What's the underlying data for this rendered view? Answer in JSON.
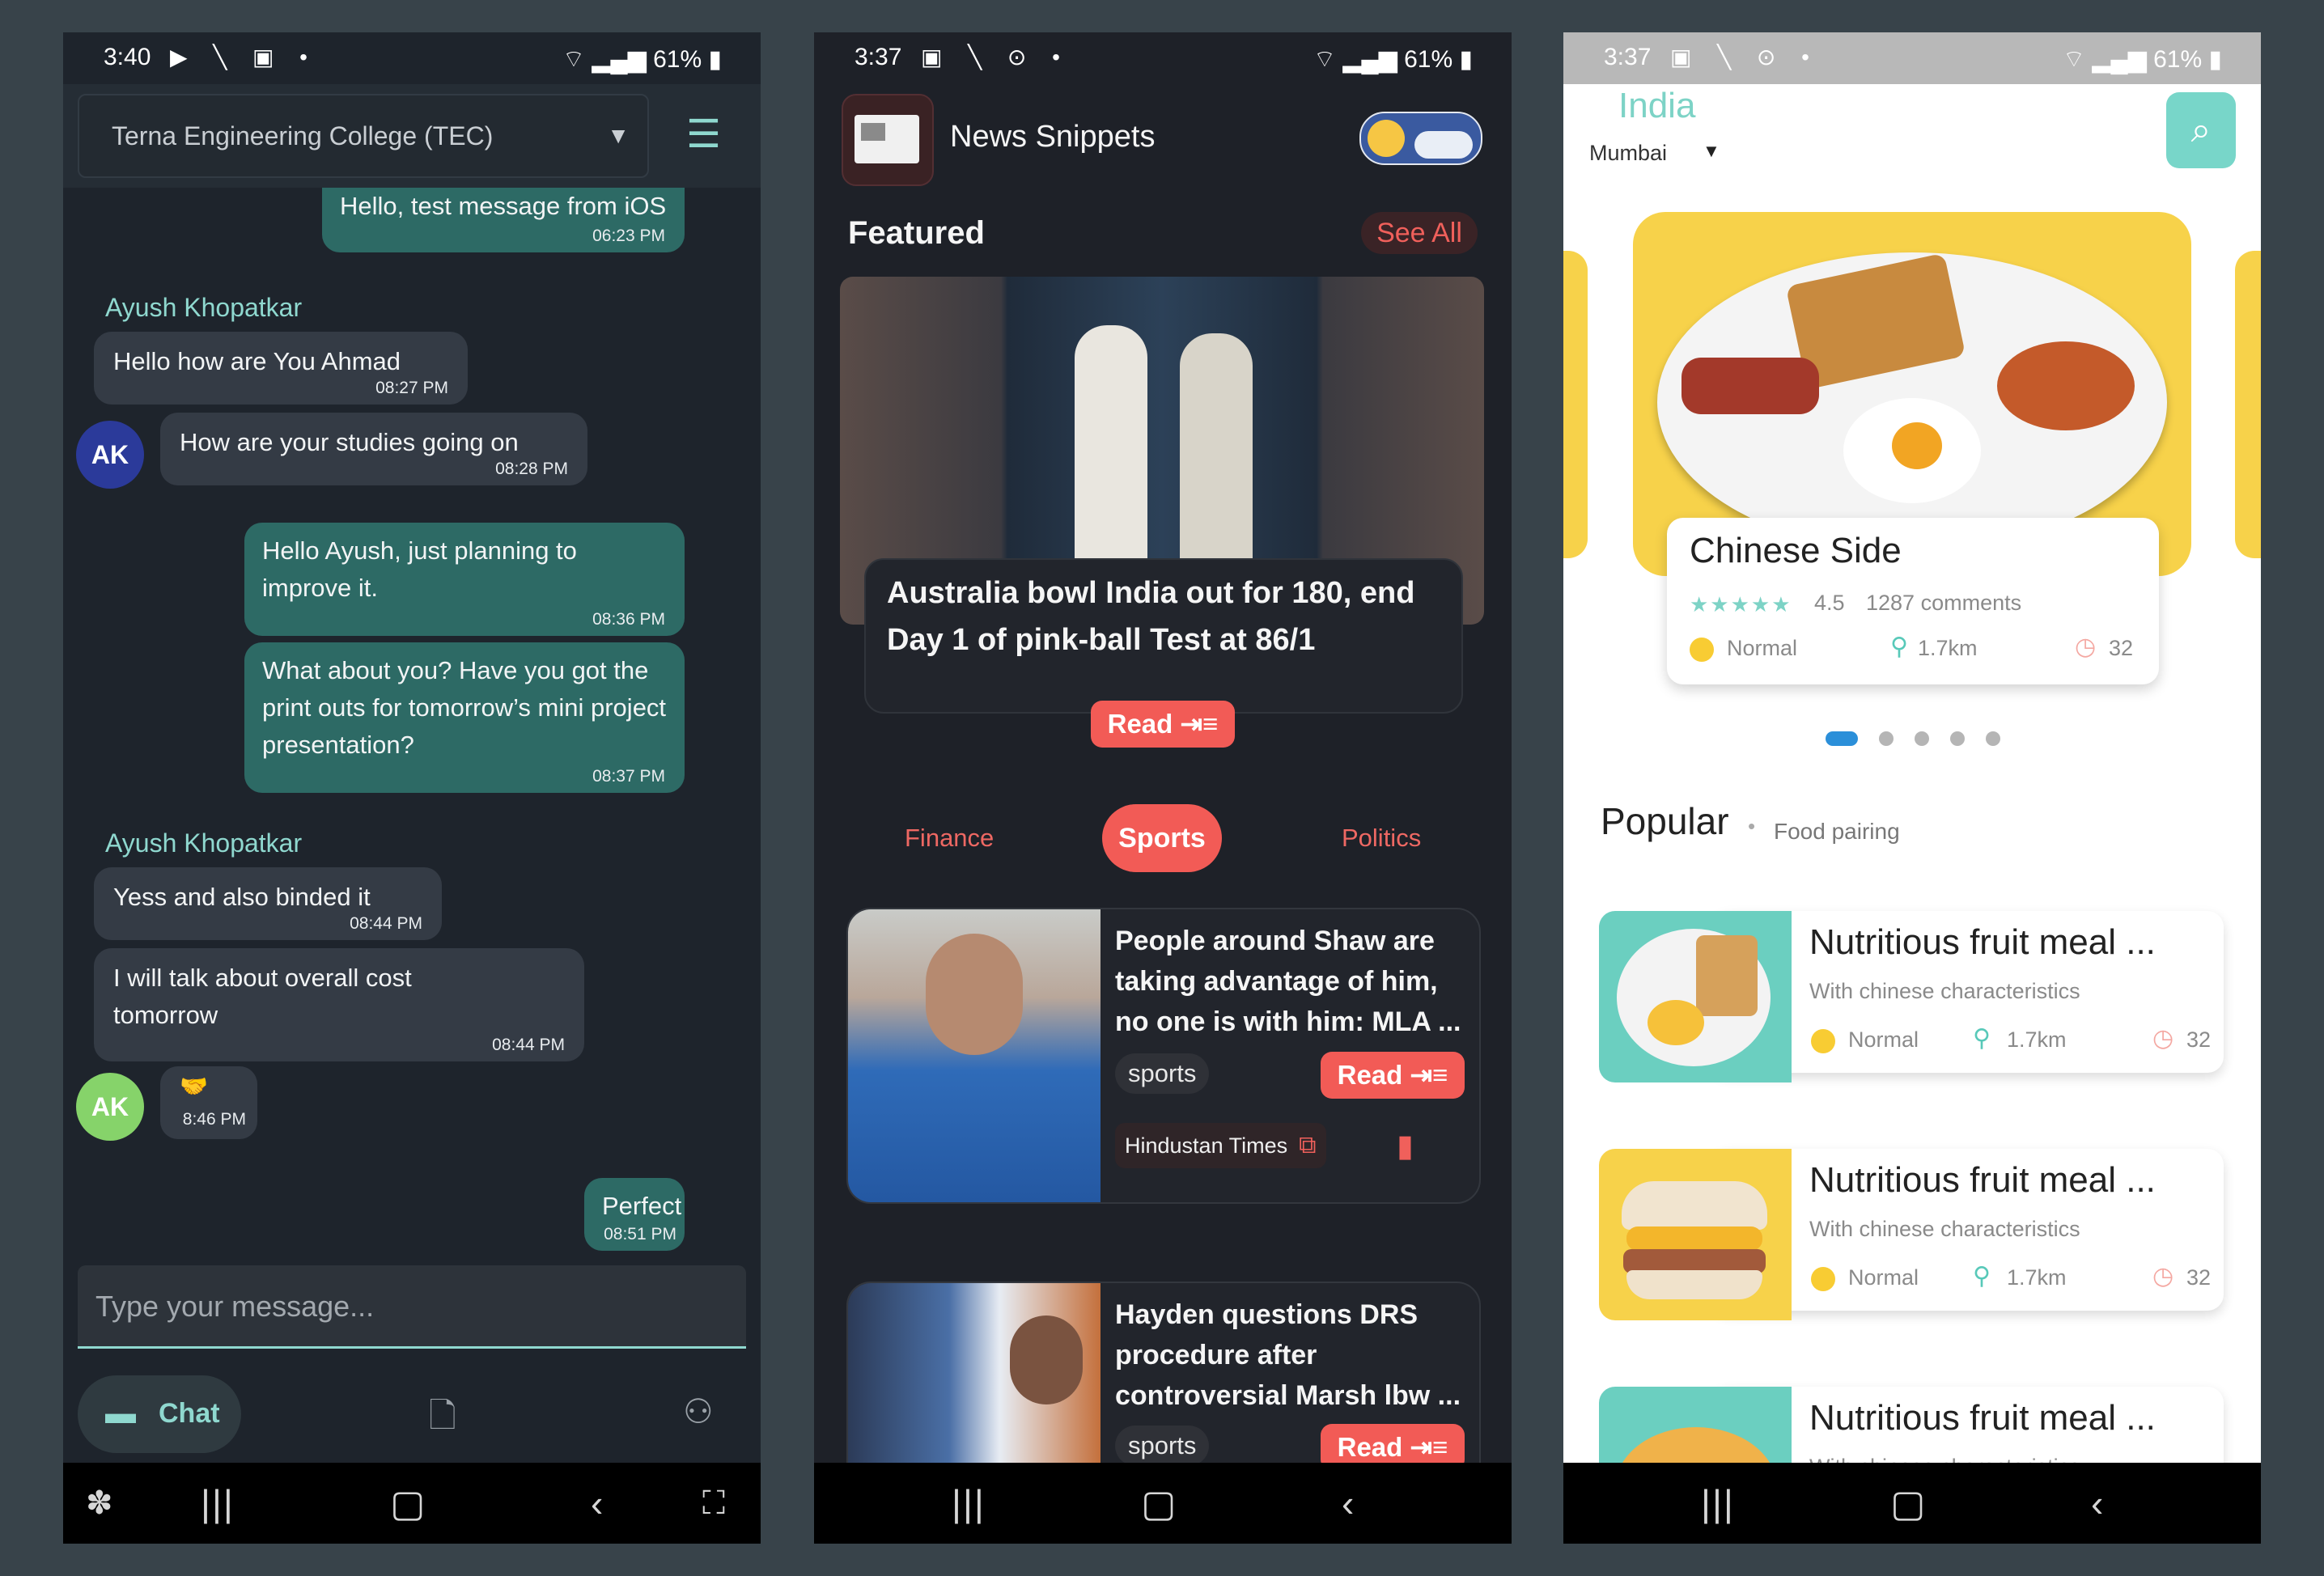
{
  "chat": {
    "status": {
      "time": "3:40",
      "battery": "61%"
    },
    "college": "Terna Engineering College (TEC)",
    "messages": {
      "m0": {
        "text": "Hello, test message from iOS",
        "time": "06:23 PM"
      },
      "s1": "Ayush Khopatkar",
      "m1": {
        "text": "Hello how are You Ahmad",
        "time": "08:27 PM"
      },
      "m2": {
        "text": "How are your studies going on",
        "time": "08:28 PM",
        "avatar": "AK"
      },
      "m3": {
        "text": "Hello Ayush, just planning to improve it.",
        "time": "08:36 PM"
      },
      "m4": {
        "text": "What about you? Have you got the print outs for tomorrow’s mini project presentation?",
        "time": "08:37 PM"
      },
      "s2": "Ayush Khopatkar",
      "m5": {
        "text": "Yess and also binded it",
        "time": "08:44 PM"
      },
      "m6": {
        "text": "I will talk about overall cost tomorrow",
        "time": "08:44 PM"
      },
      "m7": {
        "text": "🤝",
        "time": "8:46 PM",
        "avatar": "AK"
      },
      "m8": {
        "text": "Perfect",
        "time": "08:51 PM"
      }
    },
    "input_placeholder": "Type your message...",
    "tab_chat": "Chat",
    "colors": {
      "accent": "#8fd8cf",
      "sent_bubble": "#2d6a65",
      "recv_bubble": "#343b45",
      "avatar1": "#2b3a9a",
      "avatar2": "#86d36a"
    }
  },
  "news": {
    "status": {
      "time": "3:37",
      "battery": "61%"
    },
    "app_title": "News Snippets",
    "featured_heading": "Featured",
    "see_all": "See All",
    "featured_headline": "Australia bowl India out for 180, end Day 1 of pink-ball Test at 86/1",
    "read_label": "Read",
    "categories": {
      "c1": "Finance",
      "c2": "Sports",
      "c3": "Politics"
    },
    "cards": {
      "a": {
        "headline": "People around Shaw are taking advantage of him, no one is with him: MLA ...",
        "tag": "sports",
        "source": "Hindustan Times"
      },
      "b": {
        "headline": "Hayden questions DRS procedure after controversial Marsh lbw ...",
        "tag": "sports"
      }
    },
    "colors": {
      "accent": "#f25b56"
    }
  },
  "food": {
    "status": {
      "time": "3:37",
      "battery": "61%"
    },
    "country": "India",
    "city": "Mumbai",
    "hero": {
      "title": "Chinese Side",
      "rating": "4.5",
      "comments": "1287 comments",
      "level": "Normal",
      "distance": "1.7km",
      "time": "32"
    },
    "carousel": {
      "pages": 5,
      "active": 1
    },
    "popular_title": "Popular",
    "popular_sub": "Food pairing",
    "items": {
      "i1": {
        "title": "Nutritious fruit meal ...",
        "subtitle": "With chinese characteristics",
        "level": "Normal",
        "distance": "1.7km",
        "time": "32"
      },
      "i2": {
        "title": "Nutritious fruit meal ...",
        "subtitle": "With chinese characteristics",
        "level": "Normal",
        "distance": "1.7km",
        "time": "32"
      },
      "i3": {
        "title": "Nutritious fruit meal ...",
        "subtitle": "With chinese characteristics"
      }
    },
    "colors": {
      "accent": "#78d6c9",
      "yellow": "#f7d24a"
    }
  }
}
